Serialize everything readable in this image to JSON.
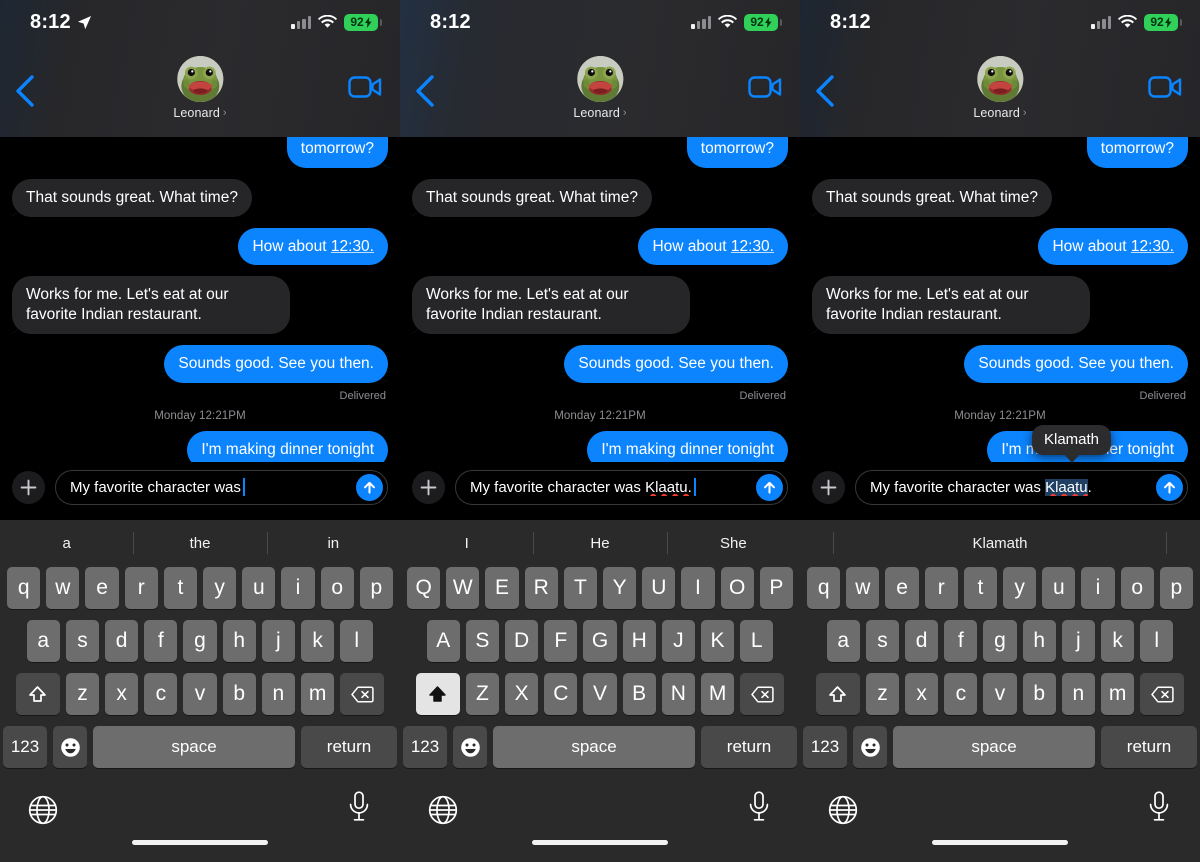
{
  "panels": [
    {
      "id": "panel-1",
      "status": {
        "time": "8:12",
        "battery_percent": "92",
        "charging": true,
        "wifi": true,
        "cell_bars": 4
      },
      "header": {
        "contact_name": "Leonard",
        "disclosure": "›"
      },
      "conversation": {
        "messages": [
          {
            "side": "out",
            "text": "tomorrow?",
            "clipped": true
          },
          {
            "side": "in",
            "text": "That sounds great. What time?"
          },
          {
            "side": "out",
            "text": "How about ",
            "underlined": "12:30."
          },
          {
            "side": "in",
            "text": "Works for me. Let's eat at our favorite Indian restaurant."
          },
          {
            "side": "out",
            "text": "Sounds good. See you then.",
            "status": "Delivered"
          }
        ],
        "daystamp": "Monday 12:21PM",
        "after_stamp": [
          {
            "side": "out",
            "text": "I'm making dinner tonight"
          }
        ]
      },
      "input": {
        "text_prefix": "My favorite character was",
        "text_word": "",
        "word_state": "none",
        "caret": true,
        "plus_icon": "plus-icon",
        "send_icon": "send-arrow-up-icon"
      },
      "popup": null,
      "keyboard": {
        "predictions": [
          "a",
          "the",
          "in"
        ],
        "single_prediction": false,
        "shift": false,
        "rows": [
          [
            "q",
            "w",
            "e",
            "r",
            "t",
            "y",
            "u",
            "i",
            "o",
            "p"
          ],
          [
            "a",
            "s",
            "d",
            "f",
            "g",
            "h",
            "j",
            "k",
            "l"
          ],
          [
            "z",
            "x",
            "c",
            "v",
            "b",
            "n",
            "m"
          ]
        ],
        "num_key": "123",
        "space_key": "space",
        "return_key": "return"
      }
    },
    {
      "id": "panel-2",
      "status": {
        "time": "8:12",
        "battery_percent": "92",
        "charging": true,
        "wifi": true,
        "cell_bars": 4
      },
      "header": {
        "contact_name": "Leonard",
        "disclosure": "›"
      },
      "conversation": {
        "messages": [
          {
            "side": "out",
            "text": "tomorrow?",
            "clipped": true
          },
          {
            "side": "in",
            "text": "That sounds great. What time?"
          },
          {
            "side": "out",
            "text": "How about ",
            "underlined": "12:30."
          },
          {
            "side": "in",
            "text": "Works for me. Let's eat at our favorite Indian restaurant."
          },
          {
            "side": "out",
            "text": "Sounds good. See you then.",
            "status": "Delivered"
          }
        ],
        "daystamp": "Monday 12:21PM",
        "after_stamp": [
          {
            "side": "out",
            "text": "I'm making dinner tonight"
          }
        ]
      },
      "input": {
        "text_prefix": "My favorite character was",
        "text_word": "Klaatu.",
        "word_state": "misspelled",
        "caret": true,
        "plus_icon": "plus-icon",
        "send_icon": "send-arrow-up-icon"
      },
      "popup": null,
      "keyboard": {
        "predictions": [
          "I",
          "He",
          "She"
        ],
        "single_prediction": false,
        "shift": true,
        "rows": [
          [
            "Q",
            "W",
            "E",
            "R",
            "T",
            "Y",
            "U",
            "I",
            "O",
            "P"
          ],
          [
            "A",
            "S",
            "D",
            "F",
            "G",
            "H",
            "J",
            "K",
            "L"
          ],
          [
            "Z",
            "X",
            "C",
            "V",
            "B",
            "N",
            "M"
          ]
        ],
        "num_key": "123",
        "space_key": "space",
        "return_key": "return"
      }
    },
    {
      "id": "panel-3",
      "status": {
        "time": "8:12",
        "battery_percent": "92",
        "charging": true,
        "wifi": true,
        "cell_bars": 4
      },
      "header": {
        "contact_name": "Leonard",
        "disclosure": "›"
      },
      "conversation": {
        "messages": [
          {
            "side": "out",
            "text": "tomorrow?",
            "clipped": true
          },
          {
            "side": "in",
            "text": "That sounds great. What time?"
          },
          {
            "side": "out",
            "text": "How about ",
            "underlined": "12:30."
          },
          {
            "side": "in",
            "text": "Works for me. Let's eat at our favorite Indian restaurant."
          },
          {
            "side": "out",
            "text": "Sounds good. See you then.",
            "status": "Delivered"
          }
        ],
        "daystamp": "Monday 12:21PM",
        "after_stamp": [
          {
            "side": "out",
            "text": "I'm making dinner tonight"
          }
        ]
      },
      "input": {
        "text_prefix": "My favorite character was",
        "text_word": "Klaatu",
        "text_suffix": ".",
        "word_state": "selected-misspelled",
        "caret": false,
        "plus_icon": "plus-icon",
        "send_icon": "send-arrow-up-icon"
      },
      "popup": {
        "text": "Klamath"
      },
      "keyboard": {
        "predictions": [
          "Klamath"
        ],
        "single_prediction": true,
        "shift": false,
        "rows": [
          [
            "q",
            "w",
            "e",
            "r",
            "t",
            "y",
            "u",
            "i",
            "o",
            "p"
          ],
          [
            "a",
            "s",
            "d",
            "f",
            "g",
            "h",
            "j",
            "k",
            "l"
          ],
          [
            "z",
            "x",
            "c",
            "v",
            "b",
            "n",
            "m"
          ]
        ],
        "num_key": "123",
        "space_key": "space",
        "return_key": "return"
      }
    }
  ],
  "icons": {
    "location": "location-arrow-icon",
    "wifi": "wifi-icon",
    "cellular": "cellular-signal-icon",
    "battery": "battery-charging-icon",
    "back": "back-chevron-icon",
    "facetime": "facetime-video-icon",
    "globe": "globe-icon",
    "mic": "microphone-icon",
    "shift": "shift-arrow-icon",
    "backspace": "backspace-delete-icon",
    "emoji": "emoji-smiley-icon",
    "home": "home-indicator"
  },
  "colors": {
    "sent_bubble": "#0b84fe",
    "received_bubble": "#262628",
    "accent_blue": "#0b84fe",
    "battery_green": "#2fd158",
    "key_face": "#6d6d6d",
    "key_dark": "#494949",
    "keyboard_bg": "#2a2a2a",
    "spell_red": "#ff3b30",
    "selection": "#1f3f63"
  }
}
